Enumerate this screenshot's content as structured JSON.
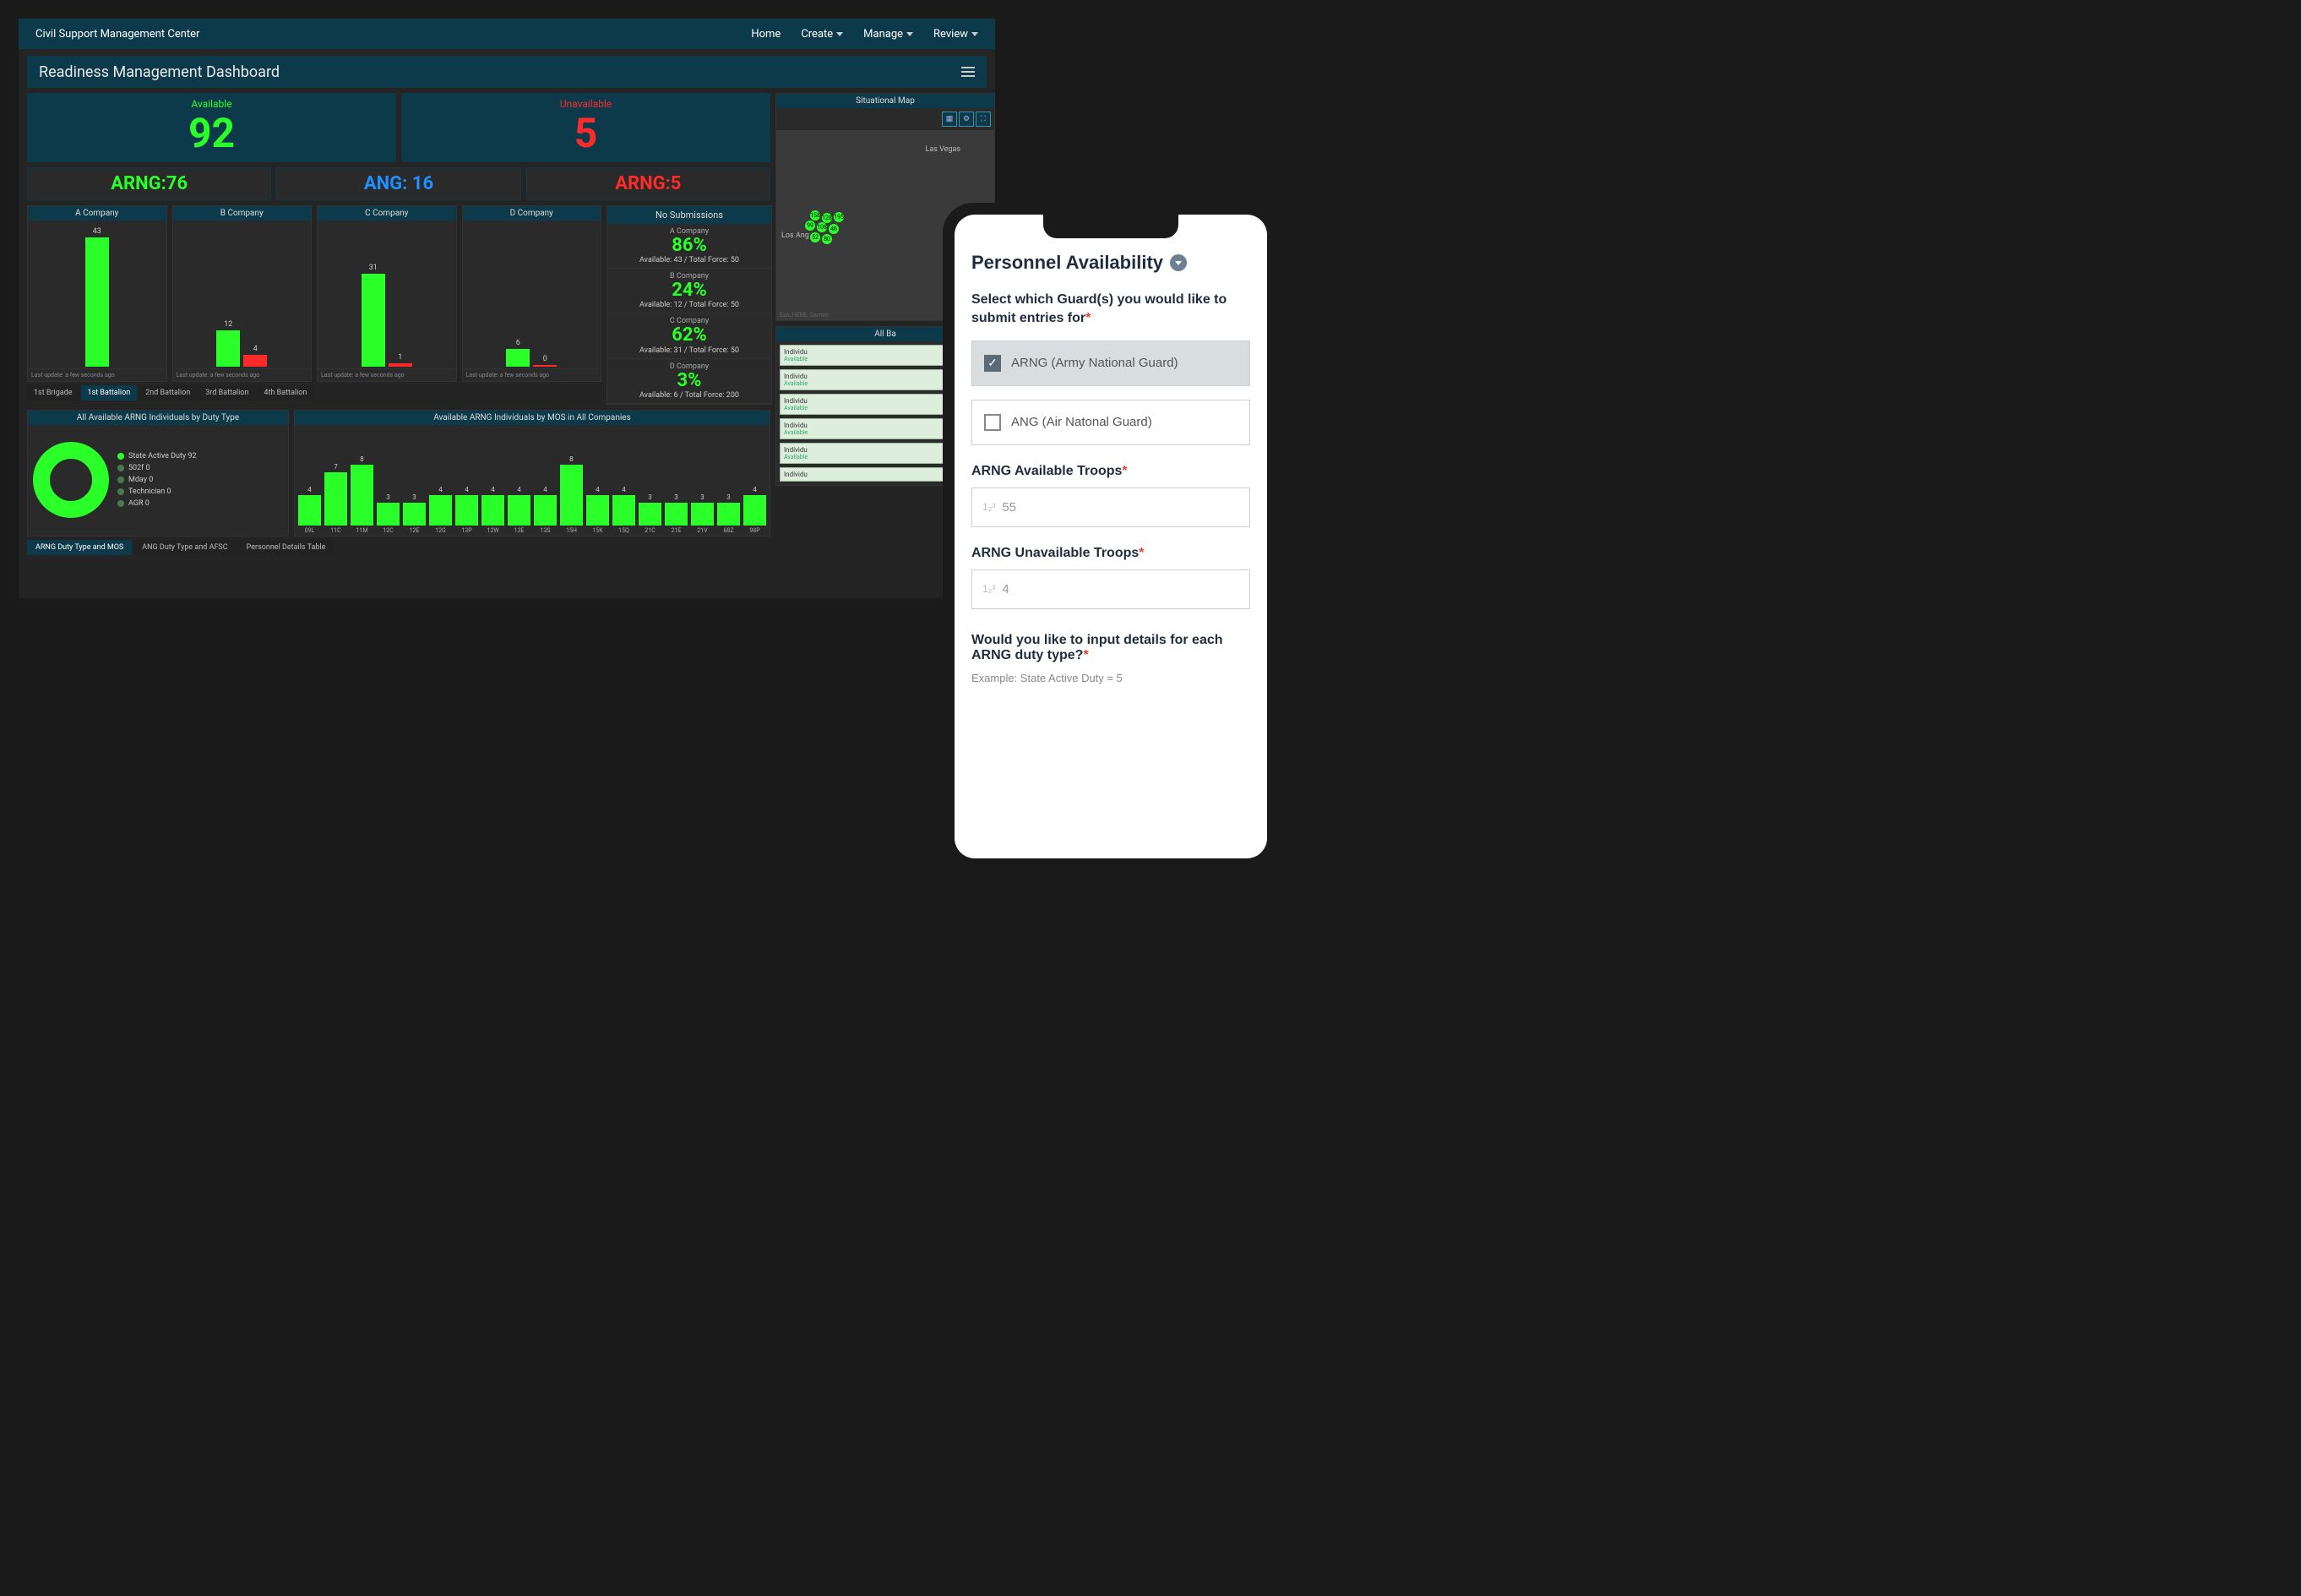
{
  "colors": {
    "green": "#2aff2a",
    "red": "#ff2a2a",
    "blue": "#1e90ff",
    "panel": "#0d3a4a"
  },
  "header": {
    "app_title": "Civil Support Management Center",
    "nav": {
      "home": "Home",
      "create": "Create",
      "manage": "Manage",
      "review": "Review"
    }
  },
  "dashboard_title": "Readiness Management Dashboard",
  "availability": {
    "available": {
      "label": "Available",
      "value": 92
    },
    "unavailable": {
      "label": "Unavailable",
      "value": 5
    },
    "sub": {
      "arng": "ARNG:76",
      "ang": "ANG: 16",
      "arng_unavail": "ARNG:5"
    }
  },
  "companies": [
    {
      "name": "A Company",
      "bars": [
        {
          "v": 43,
          "c": "g"
        }
      ],
      "foot": "Last update: a few seconds ago"
    },
    {
      "name": "B Company",
      "bars": [
        {
          "v": 12,
          "c": "g"
        },
        {
          "v": 4,
          "c": "r"
        }
      ],
      "foot": "Last update: a few seconds ago"
    },
    {
      "name": "C Company",
      "bars": [
        {
          "v": 31,
          "c": "g"
        },
        {
          "v": 1,
          "c": "r"
        }
      ],
      "foot": "Last update: a few seconds ago"
    },
    {
      "name": "D Company",
      "bars": [
        {
          "v": 6,
          "c": "g"
        },
        {
          "v": 0,
          "c": "r"
        }
      ],
      "foot": "Last update: a few seconds ago"
    }
  ],
  "company_tabs": [
    "1st Brigade",
    "1st Battalion",
    "2nd Battalion",
    "3rd Battalion",
    "4th Battalion"
  ],
  "company_tabs_active": 1,
  "no_submissions": {
    "title": "No Submissions",
    "items": [
      {
        "name": "A Company",
        "pct": "86%",
        "ratio": "Available: 43 / Total Force: 50"
      },
      {
        "name": "B Company",
        "pct": "24%",
        "ratio": "Available: 12 / Total Force: 50"
      },
      {
        "name": "C Company",
        "pct": "62%",
        "ratio": "Available: 31 / Total Force: 50"
      },
      {
        "name": "D Company",
        "pct": "3%",
        "ratio": "Available: 6 / Total Force: 200"
      }
    ]
  },
  "duty": {
    "donut_title": "All Available ARNG Individuals by Duty Type",
    "legend": [
      {
        "label": "State Active Duty",
        "value": 92
      },
      {
        "label": "502f",
        "value": 0
      },
      {
        "label": "Mday",
        "value": 0
      },
      {
        "label": "Technician",
        "value": 0
      },
      {
        "label": "AGR",
        "value": 0
      }
    ],
    "mos_title": "Available ARNG Individuals by MOS in All Companies"
  },
  "chart_data": {
    "type": "bar",
    "title": "Available ARNG Individuals by MOS in All Companies",
    "ylabel": "",
    "ylim": [
      0,
      10
    ],
    "categories": [
      "09L",
      "11C",
      "11M",
      "12C",
      "12E",
      "12G",
      "13P",
      "12W",
      "13E",
      "13S",
      "15H",
      "15K",
      "15Q",
      "21C",
      "21E",
      "21V",
      "68Z",
      "98P"
    ],
    "values": [
      4,
      7,
      8,
      3,
      3,
      4,
      4,
      4,
      4,
      4,
      8,
      4,
      4,
      3,
      3,
      3,
      3,
      4
    ]
  },
  "bottom_tabs": [
    "ARNG Duty Type and MOS",
    "ANG Duty Type and AFSC",
    "Personnel Details Table"
  ],
  "bottom_tabs_active": 0,
  "map": {
    "title": "Situational Map",
    "labels": {
      "vegas": "Las Vegas",
      "la": "Los Ang"
    },
    "attr": "Esri, HERE, Garmin",
    "controls": [
      "layers-icon",
      "gear-icon",
      "expand-icon"
    ]
  },
  "side_list": {
    "title": "All Ba",
    "items": [
      {
        "label": "Individu",
        "sub": "Available"
      },
      {
        "label": "Individu",
        "sub": "Available"
      },
      {
        "label": "Individu",
        "sub": "Available"
      },
      {
        "label": "Individu",
        "sub": "Available"
      },
      {
        "label": "Individu",
        "sub": "Available"
      },
      {
        "label": "Individu",
        "sub": ""
      }
    ]
  },
  "phone": {
    "title": "Personnel Availability",
    "prompt": "Select which Guard(s) you would like to submit entries for",
    "options": [
      {
        "label": "ARNG (Army National Guard)",
        "checked": true
      },
      {
        "label": "ANG (Air Natonal Guard)",
        "checked": false
      }
    ],
    "fields": {
      "avail_label": "ARNG Available Troops",
      "avail_value": "55",
      "unavail_label": "ARNG Unavailable Troops",
      "unavail_value": "4"
    },
    "detail_prompt": "Would you like to input details for each ARNG duty type?",
    "example": "Example: State Active Duty = 5"
  }
}
